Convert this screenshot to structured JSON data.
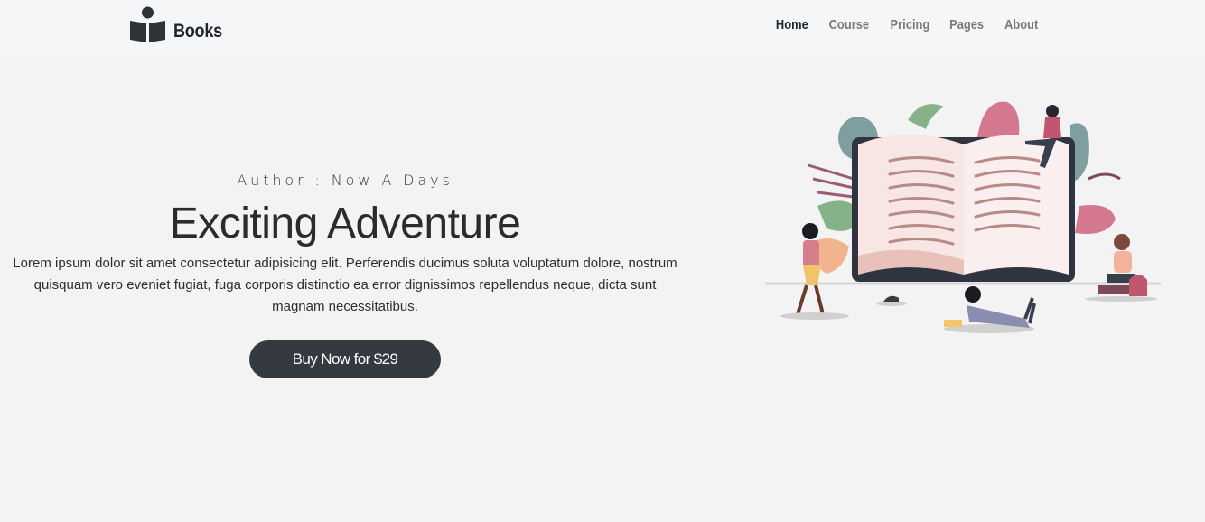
{
  "brand": {
    "name": "Books",
    "icon": "reader-book-icon"
  },
  "nav": {
    "items": [
      {
        "label": "Home",
        "active": true
      },
      {
        "label": "Course",
        "active": false
      },
      {
        "label": "Pricing",
        "active": false
      },
      {
        "label": "Pages",
        "active": false
      },
      {
        "label": "About",
        "active": false
      }
    ]
  },
  "hero": {
    "author": "Author : Now A Days",
    "title": "Exciting Adventure",
    "description": "Lorem ipsum dolor sit amet consectetur adipisicing elit. Perferendis ducimus soluta voluptatum dolore, nostrum quisquam vero eveniet fugiat, fuga corporis distinctio ea error dignissimos repellendus neque, dicta sunt magnam necessitatibus.",
    "cta_label": "Buy Now for $29"
  },
  "colors": {
    "page_bg": "#f3f3f3",
    "navbar_bg": "#f5f6f8",
    "button_bg": "#343a40",
    "text_dark": "#212529",
    "nav_inactive": "#7a7a7a"
  }
}
